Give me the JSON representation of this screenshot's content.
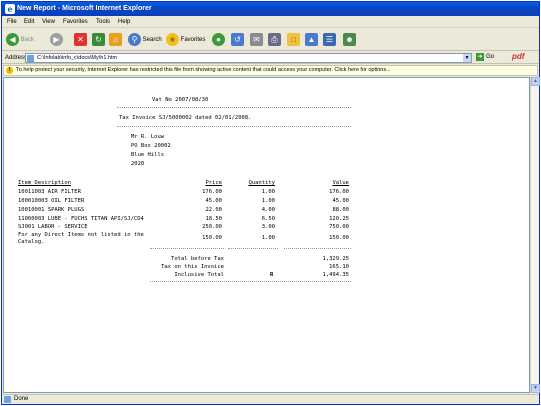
{
  "window": {
    "title": "New Report - Microsoft Internet Explorer",
    "app_icon_glyph": "e"
  },
  "menu": [
    "File",
    "Edit",
    "View",
    "Favorites",
    "Tools",
    "Help"
  ],
  "toolbar": {
    "back": "Back",
    "search": "Search",
    "favorites": "Favorites",
    "go": "Go",
    "pdf": "pdf"
  },
  "address": {
    "label": "Address",
    "value": "C:\\Infolab\\info_c\\docs\\My\\h1.htm"
  },
  "infobar": {
    "text": "To help protect your security, Internet Explorer has restricted this file from showing active content that could access your computer. Click here for options..."
  },
  "report": {
    "vat": "Vat No 2007/08/30",
    "tax_invoice": "Tax Invoice SJ/5000002 dated 02/01/2008.",
    "address_lines": [
      "Mr R. Louw",
      "PO Box 20002",
      "Blue Hills",
      "2020"
    ],
    "headers": {
      "desc": "Item Description",
      "price": "Price",
      "qty": "Quantity",
      "value": "Value"
    },
    "rows": [
      {
        "desc": "10011003 AIR FILTER",
        "price": "176.00",
        "qty": "1.00",
        "value": "176.00"
      },
      {
        "desc": "100010003 OIL FILTER",
        "price": "45.00",
        "qty": "1.00",
        "value": "45.00"
      },
      {
        "desc": "10010001 SPARK PLUGS",
        "price": "22.00",
        "qty": "4.00",
        "value": "88.00"
      },
      {
        "desc": "11000003 LUBE - FUCHS TITAN API/SJ/CD4",
        "price": "18.50",
        "qty": "6.50",
        "value": "120.25"
      },
      {
        "desc": "SJ001 LABOR - SERVICE",
        "price": "250.00",
        "qty": "3.00",
        "value": "750.00"
      },
      {
        "desc": "For any Direct Items not listed in the",
        "desc2": "Catalog.",
        "price": "150.00",
        "qty": "1.00",
        "value": "150.00"
      }
    ],
    "totals": {
      "before_tax_label": "Total before Tax",
      "before_tax": "1,329.25",
      "tax_label": "Tax on this Invoice",
      "tax": "165.10",
      "inclusive_label": "Inclusive Total",
      "currency": "R",
      "inclusive": "1,494.35"
    }
  },
  "status": {
    "text": "Done"
  }
}
